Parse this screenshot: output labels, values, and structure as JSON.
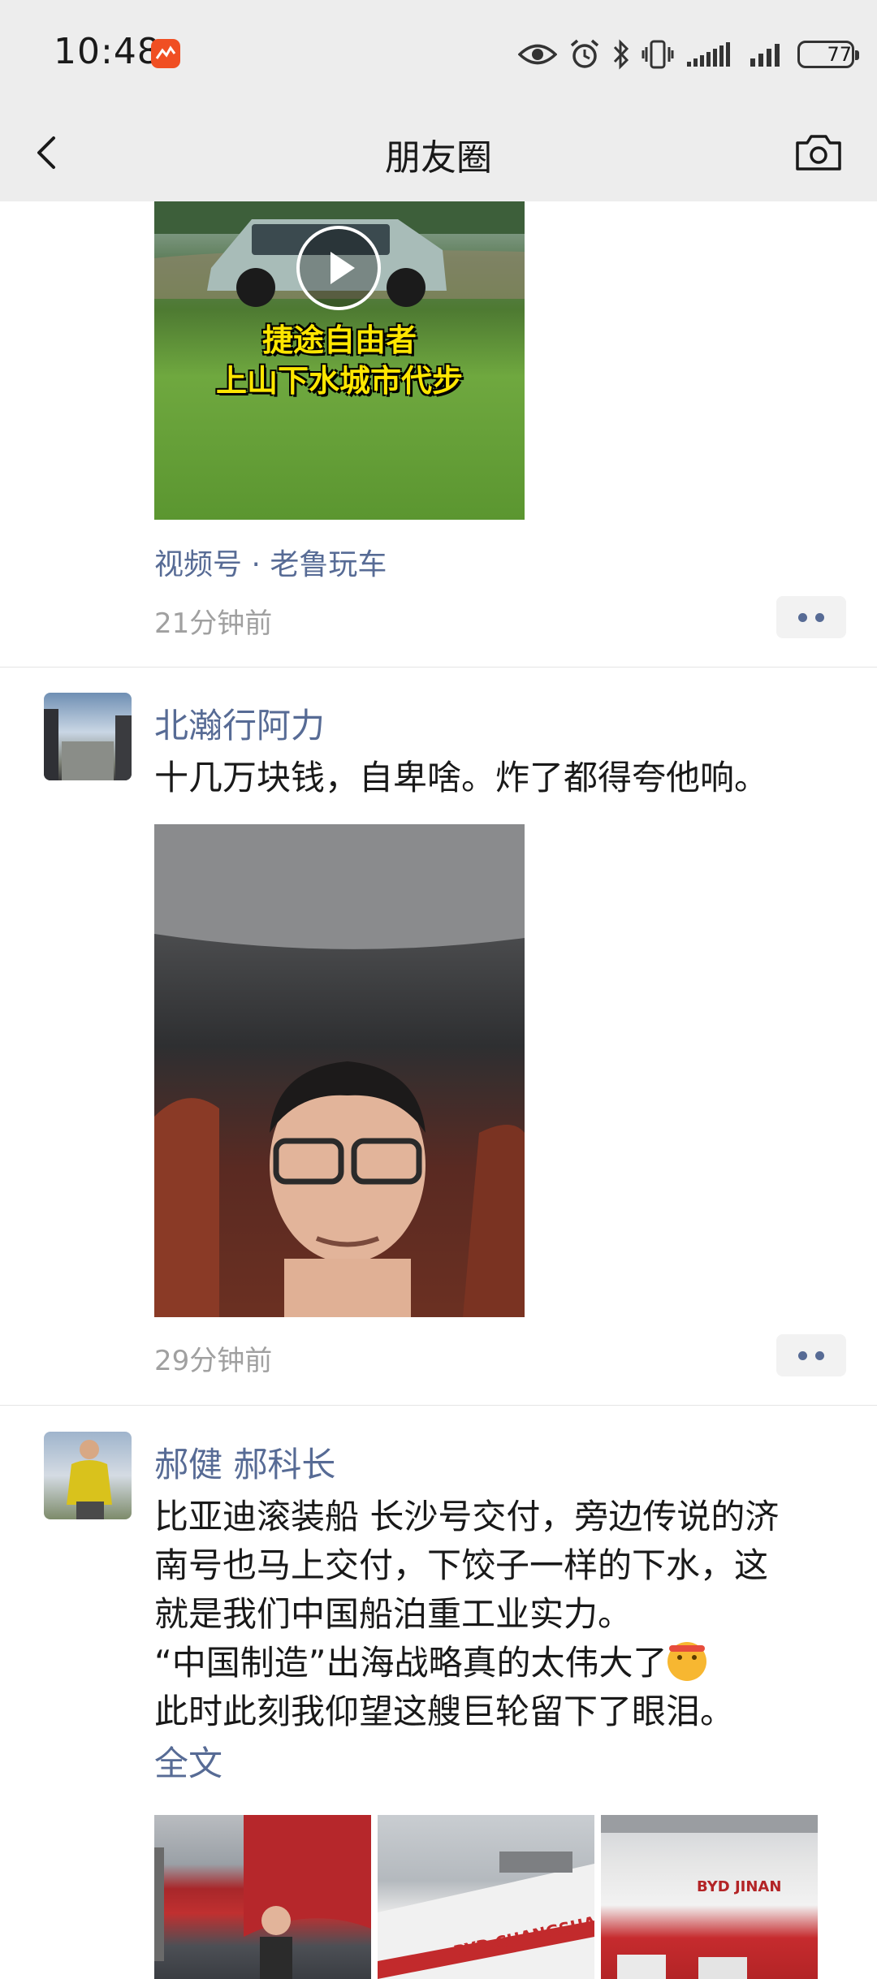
{
  "status_bar": {
    "time": "10:48",
    "battery": "77",
    "battery_level": 0.77
  },
  "nav": {
    "title": "朋友圈"
  },
  "posts": [
    {
      "video_caption_line1": "捷途自由者",
      "video_caption_line2": "上山下水城市代步",
      "source": "视频号 · 老鲁玩车",
      "time": "21分钟前"
    },
    {
      "author": "北瀚行阿力",
      "text": "十几万块钱，自卑啥。炸了都得夸他响。",
      "time": "29分钟前"
    },
    {
      "author": "郝健 郝科长",
      "lines": [
        "比亚迪滚装船 长沙号交付，旁边传说的济",
        "南号也马上交付，下饺子一样的下水，这",
        "就是我们中国船泊重工业实力。",
        "“中国制造”出海战略真的太伟大了",
        "此时此刻我仰望这艘巨轮留下了眼泪。"
      ],
      "full_text_label": "全文",
      "image_labels": [
        "BYD CHANGSHA",
        "BYD JINAN"
      ]
    }
  ],
  "colors": {
    "link": "#576b95",
    "bar_bg": "#ededed",
    "time_gray": "#a0a0a0"
  }
}
